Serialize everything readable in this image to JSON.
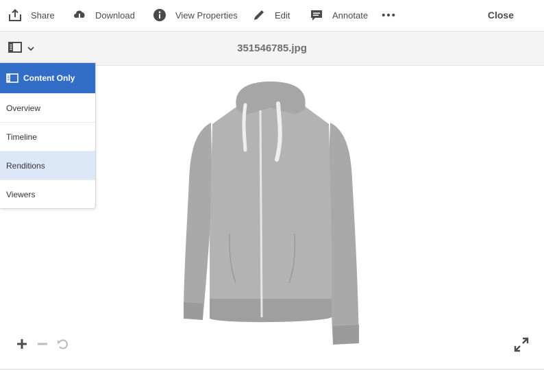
{
  "toolbar": {
    "share_label": "Share",
    "download_label": "Download",
    "view_properties_label": "View Properties",
    "edit_label": "Edit",
    "annotate_label": "Annotate",
    "more_icon": "more-icon",
    "close_label": "Close"
  },
  "titlebar": {
    "title": "351546785.jpg",
    "rail_toggle_icon": "rail-toggle-icon"
  },
  "menu": {
    "items": [
      {
        "label": "Content Only",
        "state": "selected"
      },
      {
        "label": "Overview",
        "state": "normal"
      },
      {
        "label": "Timeline",
        "state": "normal"
      },
      {
        "label": "Renditions",
        "state": "hover"
      },
      {
        "label": "Viewers",
        "state": "normal"
      }
    ]
  },
  "viewer": {
    "zoom_in_icon": "plus-icon",
    "zoom_out_icon": "minus-icon",
    "reset_icon": "reset-icon",
    "fullscreen_icon": "fullscreen-icon"
  },
  "colors": {
    "accent": "#326ec8",
    "hover": "#dce8f7",
    "titlebar_bg": "#f4f4f4",
    "icon": "#4b4b4b"
  }
}
